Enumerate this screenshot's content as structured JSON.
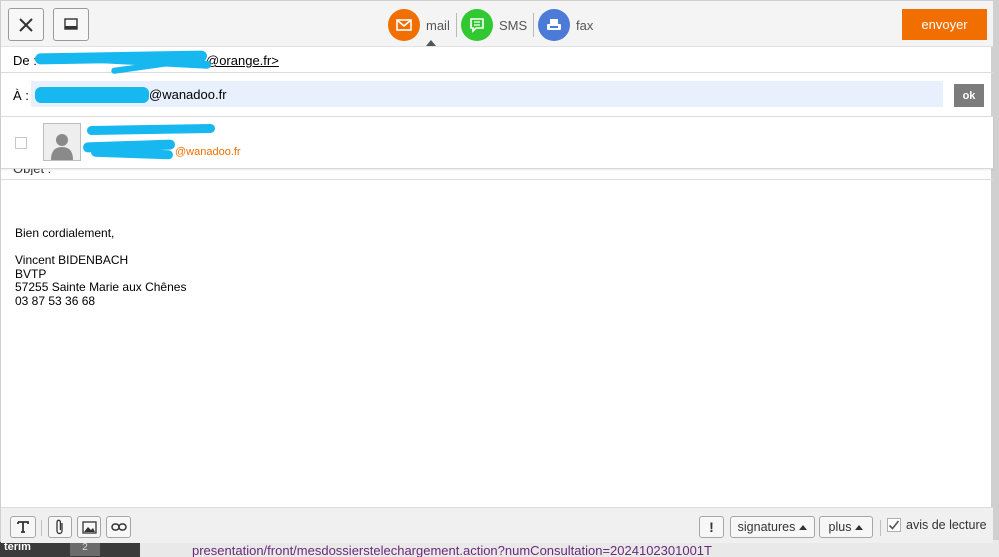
{
  "toolbar": {
    "close_icon": "close-icon",
    "minimize_icon": "minimize-icon",
    "channels": [
      {
        "label": "mail",
        "icon": "envelope-icon",
        "color": "#f16e00",
        "active": true
      },
      {
        "label": "SMS",
        "icon": "sms-icon",
        "color": "#32c832"
      },
      {
        "label": "fax",
        "icon": "fax-icon",
        "color": "#4b7bd6"
      }
    ],
    "send_label": "envoyer",
    "send_color": "#f16e00"
  },
  "from": {
    "label": "De :",
    "value": "@orange.fr>"
  },
  "to": {
    "label": "À :",
    "value": "@wanadoo.fr",
    "ok_label": "ok"
  },
  "suggestion": {
    "email": "@wanadoo.fr"
  },
  "subject": {
    "label": "Objet :"
  },
  "body": {
    "lines": [
      "Bien cordialement,",
      "",
      "Vincent BIDENBACH",
      "BVTP",
      "57255 Sainte Marie aux Chênes",
      "03 87 53 36 68"
    ]
  },
  "bottom": {
    "text_icon": "text-format-icon",
    "attach_icon": "paperclip-icon",
    "image_icon": "image-icon",
    "link_icon": "link-icon",
    "important_label": "!",
    "signatures_label": "signatures",
    "plus_label": "plus",
    "read_receipt_label": "avis de lecture",
    "read_receipt_checked": true
  },
  "background": {
    "left_label": "terim",
    "num": "2",
    "url": "presentation/front/mesdossierstelechargement.action?numConsultation=2024102301001T"
  }
}
